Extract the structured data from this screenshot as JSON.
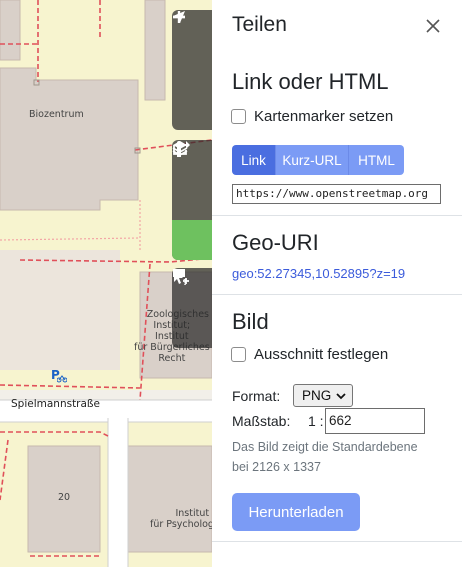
{
  "map": {
    "labels": {
      "biozentrum": "Biozentrum",
      "zoologisches": "Zoologisches\nInstitut;\nInstitut\nfür Bürgerliches\nRecht",
      "street": "Spielmannstraße",
      "house_number": "20",
      "psychologie": "Institut\nfür Psychologie",
      "parking": "P"
    },
    "controls": {
      "zoom_in": "zoom-in",
      "zoom_out": "zoom-out",
      "locate": "locate",
      "layers": "layers",
      "map_data": "info",
      "share": "share",
      "note": "add-note",
      "query": "query-features"
    }
  },
  "sidebar": {
    "title": "Teilen",
    "link_section": {
      "heading": "Link oder HTML",
      "marker_checkbox": "Kartenmarker setzen",
      "tabs": [
        "Link",
        "Kurz-URL",
        "HTML"
      ],
      "active_tab": "Link",
      "url_value": "https://www.openstreetmap.org"
    },
    "geo_section": {
      "heading": "Geo-URI",
      "uri": "geo:52.27345,10.52895?z=19"
    },
    "image_section": {
      "heading": "Bild",
      "area_checkbox": "Ausschnitt festlegen",
      "format_label": "Format:",
      "format_value": "PNG",
      "scale_label": "Maßstab:",
      "scale_prefix": "1 :",
      "scale_value": "662",
      "hint_line1": "Das Bild zeigt die Standardebene",
      "hint_line2": "bei 2126 x 1337",
      "download_label": "Herunterladen"
    }
  },
  "colors": {
    "accent": "#7b9bf5",
    "accent_active": "#4a6ee0",
    "share_active": "#6ec15f",
    "map_background": "#f2efe9",
    "building": "#d9d0c9",
    "boundary": "#e0505a"
  }
}
